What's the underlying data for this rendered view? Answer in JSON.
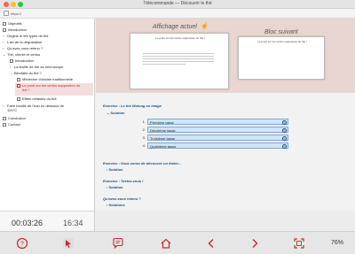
{
  "window": {
    "title": "Télécommande — Découvrir le thé"
  },
  "urlbar": {
    "url": "https://"
  },
  "sidebar": {
    "items": [
      {
        "label": "Objectifs"
      },
      {
        "label": "Introduction"
      },
      {
        "label": "Origine et les types de thé"
      },
      {
        "label": "L'art de la dégustation"
      },
      {
        "label": "Qu'avez-vous retenu ?"
      },
      {
        "label": "Thé, chimie et vertus"
      },
      {
        "label": "Introduction"
      },
      {
        "label": "La feuille de thé au microscope"
      },
      {
        "label": "Bienfaits du thé ?"
      },
      {
        "label": "Médecine chinoise traditionnelle"
      },
      {
        "label": "Le point sur les vertus supposées du"
      },
      {
        "label": "thé !"
      },
      {
        "label": "Effets néfastes du thé"
      },
      {
        "label": "Faire bouillir de l'eau en dessous de"
      },
      {
        "label": "100°C"
      },
      {
        "label": "Conclusion"
      },
      {
        "label": "Contact"
      }
    ]
  },
  "timer": {
    "elapsed": "00:03:26",
    "clock": "16:34"
  },
  "preview": {
    "current_label": "Affichage actuel",
    "next_label": "Bloc suivant",
    "current_slide_title": "Le point sur les vertus supposées du thé !",
    "next_slide_title": "Le point sur les vertus supposées du thé !"
  },
  "exercises": [
    {
      "title": "Exercice : Le thé Wulong en image",
      "solution": "Solution"
    },
    {
      "title": "Exercice : Vous venez de découvrir un théier...",
      "solution": "Solution"
    },
    {
      "title": "Exercice : Testez-vous !",
      "solution": "Solution"
    },
    {
      "title": "Qu'avez-vous retenu ?",
      "solution": "Solutions"
    }
  ],
  "steps": [
    {
      "num": "1.",
      "label": "Première tasse"
    },
    {
      "num": "2.",
      "label": "Deuxième tasse"
    },
    {
      "num": "3.",
      "label": "Troisième tasse"
    },
    {
      "num": "4.",
      "label": "Quatrième tasse"
    }
  ],
  "toolbar": {
    "zoom": "76%",
    "icons": [
      "help-icon",
      "pointer-icon",
      "comment-icon",
      "home-icon",
      "previous-icon",
      "next-icon",
      "fullscreen-icon"
    ]
  },
  "colors": {
    "accent": "#c62828",
    "preview_bg": "#e9d6d0",
    "step_bg": "#cfe6f6",
    "link": "#1f4e79"
  }
}
